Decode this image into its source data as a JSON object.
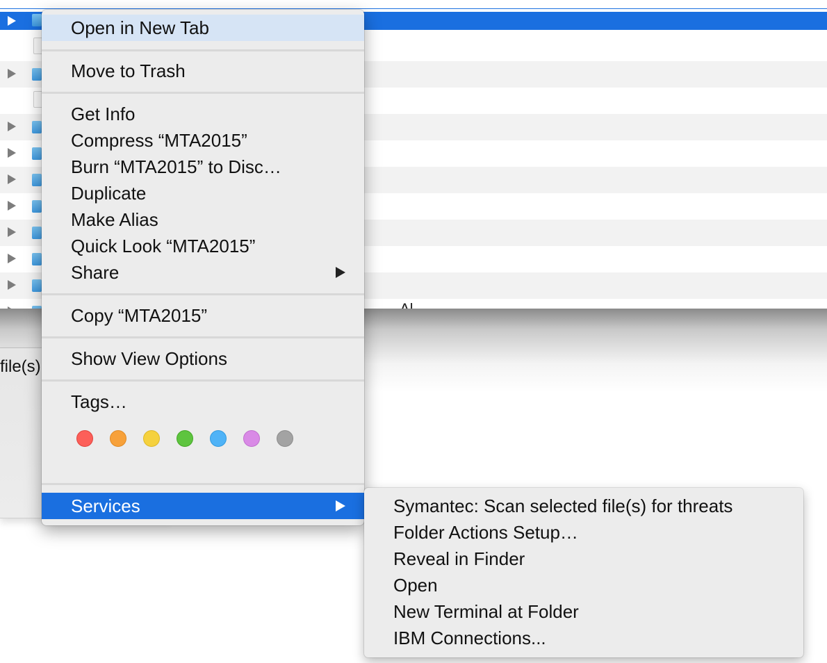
{
  "finder": {
    "selected_item": "MTA2015",
    "partial_column_text": "Al",
    "dialog_fragment_text": "file(s)"
  },
  "context_menu": {
    "open_in_new_tab": "Open in New Tab",
    "move_to_trash": "Move to Trash",
    "get_info": "Get Info",
    "compress": "Compress “MTA2015”",
    "burn": "Burn “MTA2015” to Disc…",
    "duplicate": "Duplicate",
    "make_alias": "Make Alias",
    "quick_look": "Quick Look “MTA2015”",
    "share": "Share",
    "copy": "Copy “MTA2015”",
    "show_view_options": "Show View Options",
    "tags": "Tags…",
    "tag_colors": [
      {
        "name": "red",
        "fill": "#fc5f59",
        "border": "#e0443e"
      },
      {
        "name": "orange",
        "fill": "#f7a13a",
        "border": "#e08a24"
      },
      {
        "name": "yellow",
        "fill": "#f5d13e",
        "border": "#ddb828"
      },
      {
        "name": "green",
        "fill": "#5ec43f",
        "border": "#44a826"
      },
      {
        "name": "blue",
        "fill": "#4fb3f7",
        "border": "#329adf"
      },
      {
        "name": "purple",
        "fill": "#d98ae6",
        "border": "#c070ce"
      },
      {
        "name": "gray",
        "fill": "#a3a3a3",
        "border": "#8c8c8c"
      }
    ],
    "services": "Services"
  },
  "services_submenu": {
    "items": [
      "Symantec: Scan selected file(s) for threats",
      "Folder Actions Setup…",
      "Reveal in Finder",
      "Open",
      "New Terminal at Folder",
      "IBM Connections..."
    ]
  },
  "colors": {
    "selection_blue": "#1a6fe0",
    "menu_background": "#ececec",
    "highlight_light_blue": "#d6e4f5"
  },
  "icons": [
    "disclosure-triangle-icon",
    "folder-icon",
    "file-icon",
    "submenu-arrow-icon"
  ]
}
